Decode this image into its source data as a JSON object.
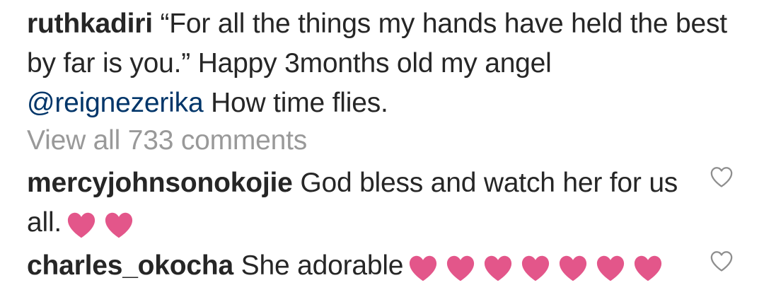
{
  "caption": {
    "username": "ruthkadiri",
    "text": "“For all the things my hands have held the best by far is you.” Happy 3months old my angel",
    "mention": "@reignezerika",
    "text_after": "How time flies."
  },
  "view_all_comments": "View all 733 comments",
  "comments": [
    {
      "username": "mercyjohnsonokojie",
      "text": "God bless and watch her for us all.",
      "hearts": 2,
      "like_icon": "heart-outline-icon"
    },
    {
      "username": "charles_okocha",
      "text": "She adorable",
      "hearts": 7,
      "like_icon": "heart-outline-icon"
    }
  ],
  "colors": {
    "text": "#262626",
    "muted": "#999999",
    "mention": "#003569",
    "heart_emoji": "#E3568A",
    "like_outline": "#8E8E8E"
  }
}
